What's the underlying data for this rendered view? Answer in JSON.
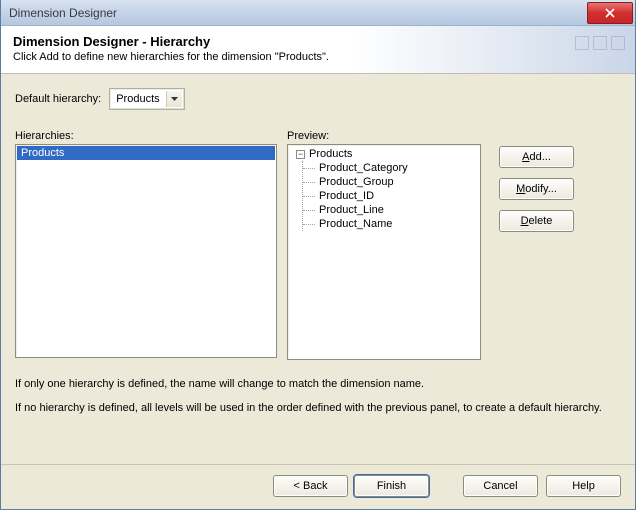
{
  "window": {
    "title": "Dimension Designer"
  },
  "header": {
    "title": "Dimension Designer - Hierarchy",
    "subtitle": "Click Add to define new hierarchies for the dimension \"Products\"."
  },
  "default_hierarchy": {
    "label": "Default hierarchy:",
    "value": "Products"
  },
  "hierarchies": {
    "label": "Hierarchies:",
    "items": [
      "Products"
    ],
    "selected_index": 0
  },
  "preview": {
    "label": "Preview:",
    "root": "Products",
    "children": [
      "Product_Category",
      "Product_Group",
      "Product_ID",
      "Product_Line",
      "Product_Name"
    ]
  },
  "side_buttons": {
    "add": "Add...",
    "modify": "Modify...",
    "delete": "Delete"
  },
  "notes": {
    "line1": "If only one hierarchy is defined, the name will change to match the dimension name.",
    "line2": "If no hierarchy is defined, all levels will be used in the order defined with the previous panel, to create a default hierarchy."
  },
  "footer": {
    "back": "< Back",
    "finish": "Finish",
    "cancel": "Cancel",
    "help": "Help"
  }
}
